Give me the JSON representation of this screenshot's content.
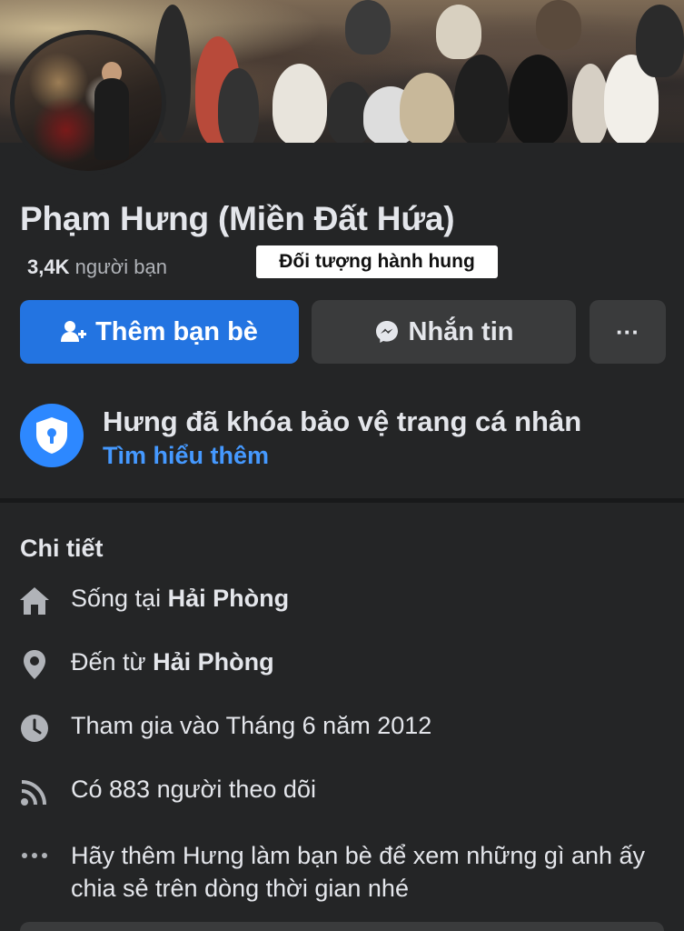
{
  "profile": {
    "name": "Phạm Hưng (Miền Đất Hứa)",
    "friends_count": "3,4K",
    "friends_label": "người bạn"
  },
  "caption_overlay": "Đối tượng hành hung",
  "actions": {
    "add_friend": "Thêm bạn bè",
    "message": "Nhắn tin",
    "more": "···"
  },
  "lock_notice": {
    "title": "Hưng đã khóa bảo vệ trang cá nhân",
    "link": "Tìm hiểu thêm"
  },
  "details": {
    "title": "Chi tiết",
    "lives_in_prefix": "Sống tại",
    "lives_in": "Hải Phòng",
    "from_prefix": "Đến từ",
    "from": "Hải Phòng",
    "joined": "Tham gia vào Tháng 6 năm 2012",
    "followers": "Có 883 người theo dõi",
    "add_prompt": "Hãy thêm Hưng làm bạn bè để xem những gì anh ấy chia sẻ trên dòng thời gian nhé"
  },
  "colors": {
    "background": "#242526",
    "primary_button": "#2374e1",
    "secondary_button": "#3a3b3c",
    "link": "#4599ff",
    "lock_badge": "#2d88ff"
  },
  "icons": [
    "user-plus-icon",
    "messenger-icon",
    "shield-lock-icon",
    "home-icon",
    "location-pin-icon",
    "clock-icon",
    "rss-icon",
    "more-dots-icon"
  ]
}
